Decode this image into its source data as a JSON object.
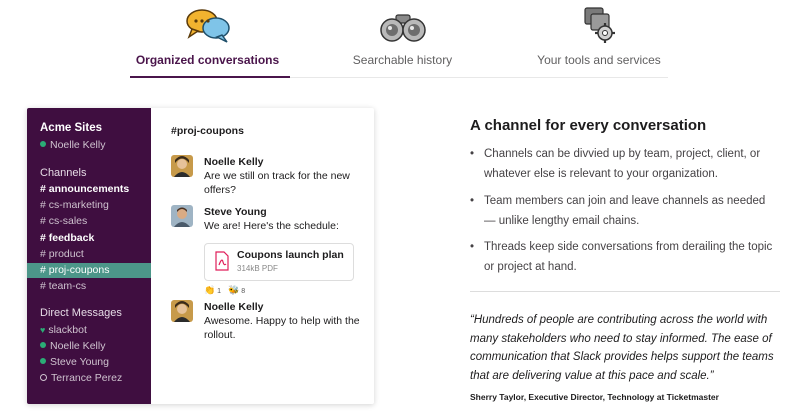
{
  "tabs": [
    {
      "label": "Organized conversations",
      "icon": "chat-bubbles-icon",
      "active": true
    },
    {
      "label": "Searchable history",
      "icon": "binoculars-icon",
      "active": false
    },
    {
      "label": "Your tools and services",
      "icon": "gear-tools-icon",
      "active": false
    }
  ],
  "colors": {
    "brand": "#4a154b",
    "sidebar": "#3f0e40",
    "active_channel": "#4c9689",
    "presence": "#2bac76"
  },
  "app": {
    "workspace": "Acme Sites",
    "user": "Noelle Kelly",
    "channels_header": "Channels",
    "channels": [
      {
        "label": "# announcements",
        "bold": true
      },
      {
        "label": "# cs-marketing",
        "bold": false
      },
      {
        "label": "# cs-sales",
        "bold": false
      },
      {
        "label": "# feedback",
        "bold": true
      },
      {
        "label": "# product",
        "bold": false
      },
      {
        "label": "# proj-coupons",
        "active": true
      },
      {
        "label": "# team-cs",
        "bold": false
      }
    ],
    "dm_header": "Direct Messages",
    "dms": [
      {
        "label": "slackbot",
        "status": "heart"
      },
      {
        "label": "Noelle Kelly",
        "status": "online"
      },
      {
        "label": "Steve Young",
        "status": "online"
      },
      {
        "label": "Terrance Perez",
        "status": "away"
      }
    ],
    "channel_title": "#proj-coupons",
    "messages": [
      {
        "author": "Noelle Kelly",
        "text": "Are we still on track for the new offers?"
      },
      {
        "author": "Steve Young",
        "text": "We are! Here's the schedule:",
        "file": {
          "name": "Coupons launch plan",
          "meta": "314kB PDF"
        },
        "reactions": [
          {
            "emoji": "👏",
            "count": "1"
          },
          {
            "emoji": "🐝",
            "count": "8"
          }
        ]
      },
      {
        "author": "Noelle Kelly",
        "text": "Awesome. Happy to help with the rollout."
      }
    ]
  },
  "content": {
    "title": "A channel for every conversation",
    "bullets": [
      "Channels can be divvied up by team, project, client, or whatever else is relevant to your organization.",
      "Team members can join and leave channels as needed — unlike lengthy email chains.",
      "Threads keep side conversations from derailing the topic or project at hand."
    ],
    "quote": "“Hundreds of people are contributing across the world with many stakeholders who need to stay informed. The ease of communication that Slack provides helps support the teams that are delivering value at this pace and scale.”",
    "attribution": "Sherry Taylor, Executive Director, Technology at Ticketmaster"
  }
}
